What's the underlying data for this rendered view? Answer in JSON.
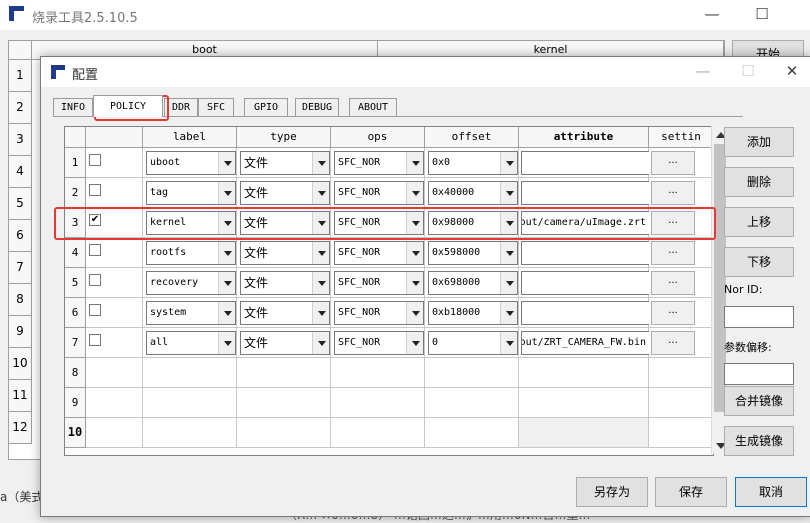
{
  "main_window": {
    "title": "烧录工具2.5.10.5",
    "controls": {
      "minimize": "—",
      "maximize": "☐",
      "close": "✕"
    },
    "grid_headers": [
      "boot",
      "kernel"
    ],
    "row_numbers": [
      "1",
      "2",
      "3",
      "4",
      "5",
      "6",
      "7",
      "8",
      "9",
      "10",
      "11",
      "12"
    ],
    "start_button": "开始",
    "bottom_text": "a（美式",
    "bottom_text2": "（R…  ×0…0…8）  …诺回…达…沪…用…0N…日…重…"
  },
  "dialog": {
    "title": "配置",
    "controls": {
      "minimize": "—",
      "maximize": "☐",
      "close": "✕"
    },
    "tabs": [
      "INFO",
      "POLICY",
      "DDR",
      "SFC",
      "GPIO",
      "DEBUG",
      "ABOUT"
    ],
    "active_tab": "POLICY",
    "table": {
      "columns": [
        "",
        "label",
        "type",
        "ops",
        "offset",
        "attribute",
        "settin"
      ],
      "rows": [
        {
          "num": "1",
          "checked": false,
          "label": "uboot",
          "type": "文件",
          "ops": "SFC_NOR",
          "offset": "0x0",
          "attribute": "",
          "setting": "..."
        },
        {
          "num": "2",
          "checked": false,
          "label": "tag",
          "type": "文件",
          "ops": "SFC_NOR",
          "offset": "0x40000",
          "attribute": "",
          "setting": "..."
        },
        {
          "num": "3",
          "checked": true,
          "label": "kernel",
          "type": "文件",
          "ops": "SFC_NOR",
          "offset": "0x98000",
          "attribute": "out/camera/uImage.zrt",
          "setting": "..."
        },
        {
          "num": "4",
          "checked": false,
          "label": "rootfs",
          "type": "文件",
          "ops": "SFC_NOR",
          "offset": "0x598000",
          "attribute": "",
          "setting": "..."
        },
        {
          "num": "5",
          "checked": false,
          "label": "recovery",
          "type": "文件",
          "ops": "SFC_NOR",
          "offset": "0x698000",
          "attribute": "",
          "setting": "..."
        },
        {
          "num": "6",
          "checked": false,
          "label": "system",
          "type": "文件",
          "ops": "SFC_NOR",
          "offset": "0xb18000",
          "attribute": "",
          "setting": "..."
        },
        {
          "num": "7",
          "checked": false,
          "label": "all",
          "type": "文件",
          "ops": "SFC_NOR",
          "offset": "0",
          "attribute": "out/ZRT_CAMERA_FW.bin",
          "setting": "..."
        }
      ],
      "empty_rows": [
        "8",
        "9",
        "10"
      ]
    },
    "side": {
      "add": "添加",
      "delete": "删除",
      "move_up": "上移",
      "move_down": "下移",
      "nor_id_label": "Nor ID:",
      "nor_id_value": "",
      "param_offset_label": "参数偏移:",
      "param_offset_value": "",
      "merge_image": "合并镜像",
      "generate_image": "生成镜像"
    },
    "bottom": {
      "save_as": "另存为",
      "save": "保存",
      "cancel": "取消"
    },
    "highlight_color": "#e53935"
  }
}
